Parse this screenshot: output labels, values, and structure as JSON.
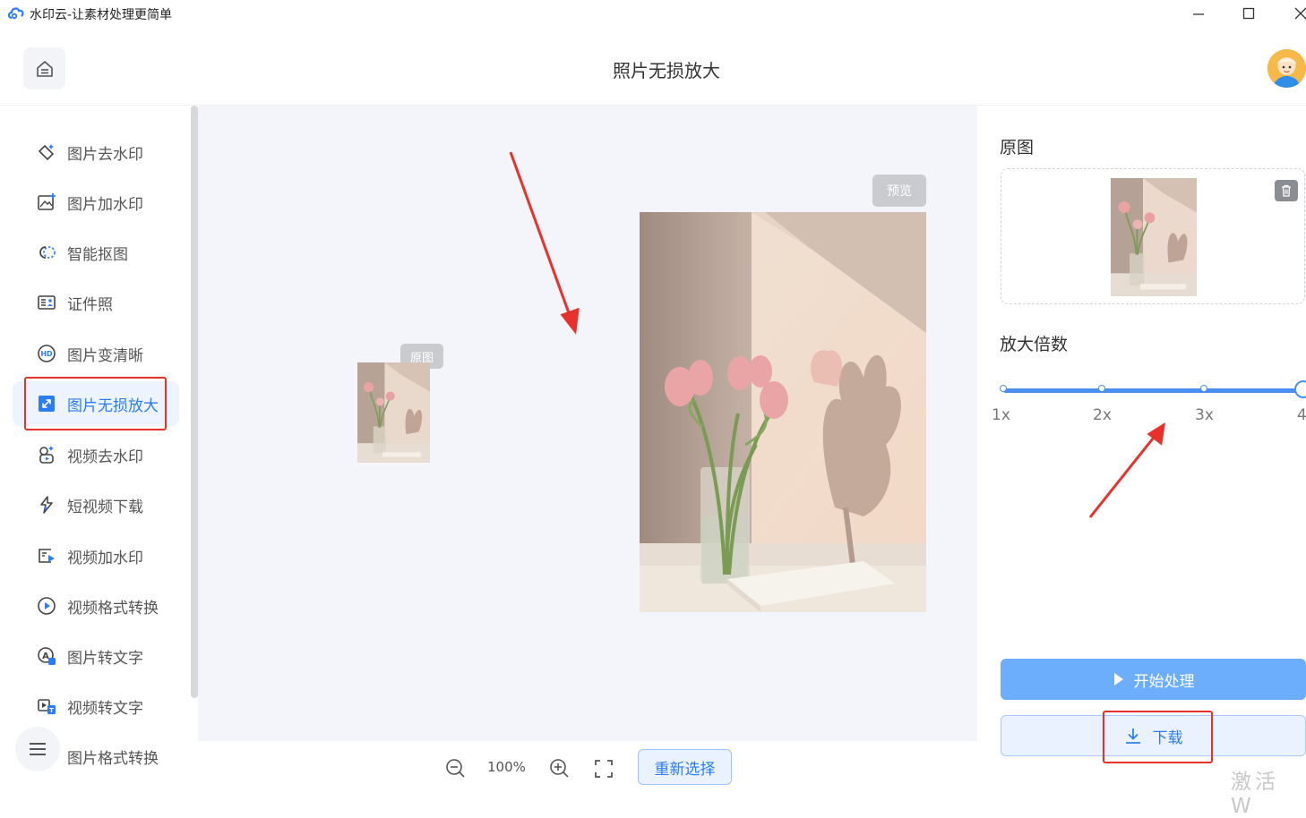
{
  "window": {
    "title": "水印云-让素材处理更简单"
  },
  "header": {
    "page_title": "照片无损放大"
  },
  "sidebar": {
    "items": [
      {
        "label": "图片去水印",
        "icon": "eraser-icon"
      },
      {
        "label": "图片加水印",
        "icon": "image-add-watermark-icon"
      },
      {
        "label": "智能抠图",
        "icon": "cutout-icon"
      },
      {
        "label": "证件照",
        "icon": "id-card-icon"
      },
      {
        "label": "图片变清晰",
        "icon": "hd-icon"
      },
      {
        "label": "图片无损放大",
        "icon": "enlarge-icon",
        "active": true
      },
      {
        "label": "视频去水印",
        "icon": "video-remove-watermark-icon"
      },
      {
        "label": "短视频下载",
        "icon": "short-video-download-icon"
      },
      {
        "label": "视频加水印",
        "icon": "video-add-watermark-icon"
      },
      {
        "label": "视频格式转换",
        "icon": "video-convert-icon"
      },
      {
        "label": "图片转文字",
        "icon": "image-to-text-icon"
      },
      {
        "label": "视频转文字",
        "icon": "video-to-text-icon"
      },
      {
        "label": "图片格式转换",
        "icon": "image-convert-icon"
      }
    ]
  },
  "canvas": {
    "original_tag": "原图",
    "preview_tag": "预览"
  },
  "bottombar": {
    "zoom_level": "100%",
    "reselect_label": "重新选择"
  },
  "right_panel": {
    "original_title": "原图",
    "scale_title": "放大倍数",
    "scale_ticks": [
      "1x",
      "2x",
      "3x",
      "4"
    ],
    "scale_selected": "4x",
    "start_label": "开始处理",
    "download_label": "下载",
    "watermark_text": "激活 W"
  },
  "colors": {
    "accent": "#2b7cf6",
    "annotation_red": "#e8312a",
    "start_button": "#6caefc"
  }
}
